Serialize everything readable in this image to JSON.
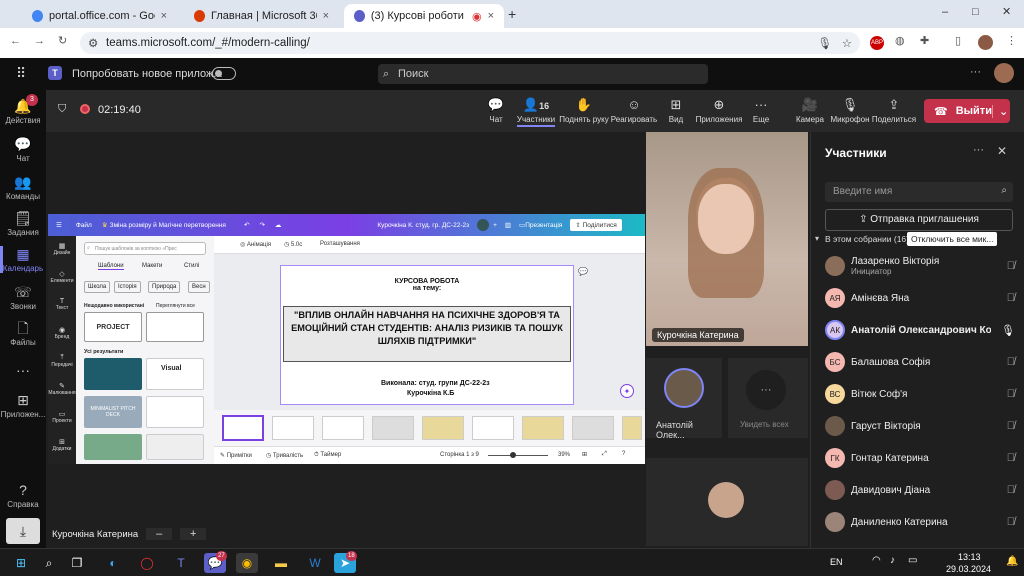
{
  "browser": {
    "tabs": [
      {
        "title": "portal.office.com - Google Sear"
      },
      {
        "title": "Главная | Microsoft 365"
      },
      {
        "title": "(3) Курсові роботи (захист"
      }
    ],
    "url": "teams.microsoft.com/_#/modern-calling/"
  },
  "teams_header": {
    "new_app_label": "Попробовать новое прилож...",
    "search_placeholder": "Поиск"
  },
  "rail": [
    {
      "label": "Действия",
      "icon": "bell-icon",
      "badge": "3"
    },
    {
      "label": "Чат",
      "icon": "chat-icon"
    },
    {
      "label": "Команды",
      "icon": "teams-icon"
    },
    {
      "label": "Задания",
      "icon": "assignments-icon"
    },
    {
      "label": "Календарь",
      "icon": "calendar-icon"
    },
    {
      "label": "Звонки",
      "icon": "phone-icon"
    },
    {
      "label": "Файлы",
      "icon": "file-icon"
    },
    {
      "label": "Приложен...",
      "icon": "apps-icon"
    },
    {
      "label": "Справка",
      "icon": "help-icon"
    }
  ],
  "meeting": {
    "timer": "02:19:40",
    "controls": {
      "chat": "Чат",
      "participants": "Участники",
      "participants_count": "16",
      "raise_hand": "Поднять руку",
      "react": "Реагировать",
      "view": "Вид",
      "apps": "Приложения",
      "more": "Еще",
      "camera": "Камера",
      "mic": "Микрофон",
      "share": "Поделиться",
      "leave": "Выйти"
    },
    "presenter_name": "Курочкіна Катерина",
    "tiles": {
      "main_video_name": "Курочкіна Катерина",
      "small_tile_name": "Анатолій Олек...",
      "see_all": "Увидеть всех"
    }
  },
  "canva": {
    "menu_file": "Файл",
    "resize": "Зміна розміру й Магічне перетворення",
    "doc_title": "Курочкіна К. студ. гр. ДС-22-2з",
    "presentation": "Презентація",
    "share": "Поділитися",
    "animation": "Анімація",
    "duration": "5.0с",
    "position": "Розташування",
    "search_placeholder": "Пошук шаблонів за копіткою «Прес",
    "tabs": [
      "Шаблони",
      "Макети",
      "Стилі"
    ],
    "chips": [
      "Школа",
      "Історія",
      "Природа",
      "Весн"
    ],
    "recent_label": "Нещодавно використані",
    "see_all": "Переглянути все",
    "all_results": "Усі результати",
    "sidebar": [
      "Дизайн",
      "Елементи",
      "Текст",
      "Бренд",
      "Передачі",
      "Малювання",
      "Проекти",
      "Додатки"
    ],
    "thumbs": [
      "PROJECT",
      "Visual",
      "MINIMALIST PITCH DECK"
    ],
    "slide": {
      "heading1": "КУРСОВА РОБОТА",
      "heading2": "на тему:",
      "title": "\"ВПЛИВ ОНЛАЙН НАВЧАННЯ НА ПСИХІЧНЕ ЗДОРОВ'Я ТА ЕМОЦІЙНИЙ СТАН СТУДЕНТІВ: АНАЛІЗ РИЗИКІВ ТА ПОШУК ШЛЯХІВ ПІДТРИМКИ\"",
      "author1": "Виконала: студ. групи  ДС-22-2з",
      "author2": "Курочкіна К.Б"
    },
    "notes": "Примітки",
    "duration_label": "Тривалість",
    "timer_label": "Таймер",
    "page": "Сторінка 1 з 9",
    "zoom": "39%"
  },
  "participants_panel": {
    "title": "Участники",
    "search_placeholder": "Введите имя",
    "invite": "Отправка приглашения",
    "in_meeting": "В этом собрании (16)",
    "mute_all": "Отключить все мик...",
    "people": [
      {
        "name": "Лазаренко Вікторія",
        "role": "Инициатор",
        "initials": "",
        "color": "#8a6e5a"
      },
      {
        "name": "Амінєва Яна",
        "initials": "АЯ",
        "color": "#f4b8b0"
      },
      {
        "name": "Анатолій Олександрович Ко...",
        "initials": "АК",
        "color": "#d9c7f0"
      },
      {
        "name": "Балашова Софія",
        "initials": "БС",
        "color": "#f4b8b0"
      },
      {
        "name": "Вітюк Соф'я",
        "initials": "ВС",
        "color": "#f6d79c"
      },
      {
        "name": "Гаруст Вікторія",
        "initials": "",
        "color": "#6b5a4a"
      },
      {
        "name": "Гонтар Катерина",
        "initials": "ГК",
        "color": "#f4b8b0"
      },
      {
        "name": "Давидович Діана",
        "initials": "",
        "color": "#7d5b52"
      },
      {
        "name": "Даниленко Катерина",
        "initials": "",
        "color": "#9a8578"
      }
    ]
  },
  "taskbar": {
    "lang": "EN",
    "time": "13:13",
    "date": "29.03.2024",
    "teams_badge": "27",
    "telegram_badge": "18"
  }
}
